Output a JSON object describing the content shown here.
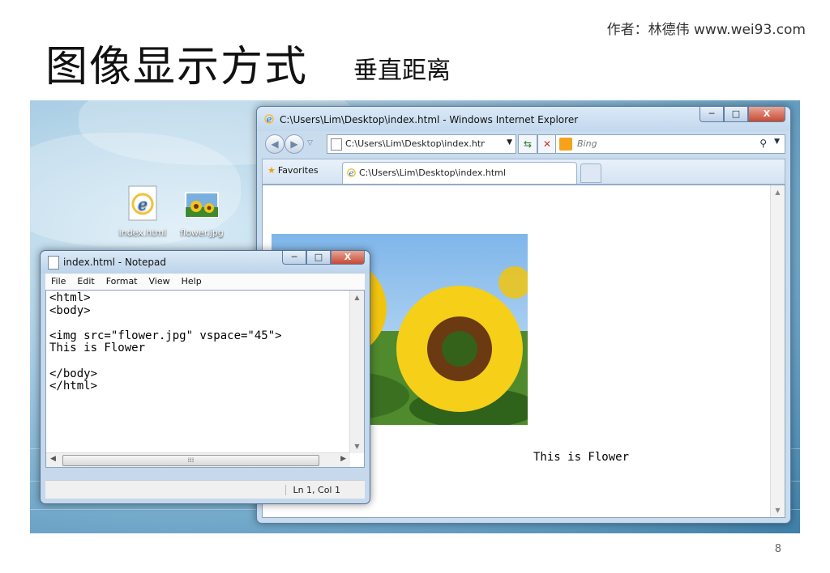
{
  "slide": {
    "author": "作者：林德伟 www.wei93.com",
    "title": "图像显示方式",
    "subtitle": "垂直距离",
    "page_number": "8"
  },
  "desktop": {
    "icons": [
      {
        "label": "index.html",
        "icon": "ie-file-icon"
      },
      {
        "label": "flower.jpg",
        "icon": "image-file-icon"
      }
    ]
  },
  "ie_window": {
    "title": "C:\\Users\\Lim\\Desktop\\index.html - Windows Internet Explorer",
    "address": "C:\\Users\\Lim\\Desktop\\index.htm",
    "search_placeholder": "Bing",
    "favorites_label": "Favorites",
    "tab_title": "C:\\Users\\Lim\\Desktop\\index.html",
    "page_caption": "This is Flower"
  },
  "notepad": {
    "title": "index.html - Notepad",
    "menu": [
      "File",
      "Edit",
      "Format",
      "View",
      "Help"
    ],
    "content": "<html>\n<body>\n\n<img src=\"flower.jpg\" vspace=\"45\">\nThis is Flower\n\n</body>\n</html>",
    "status": "Ln 1, Col 1"
  },
  "window_buttons": {
    "minimize": "─",
    "maximize": "□",
    "close": "X"
  },
  "colors": {
    "close_button": "#c74a34",
    "desktop": "#6fa6c8",
    "bing_logo": "#f6a31b"
  }
}
